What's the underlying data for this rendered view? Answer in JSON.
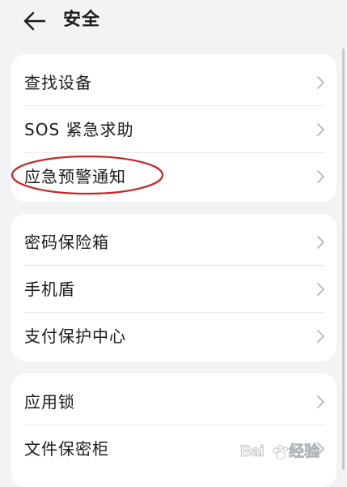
{
  "header": {
    "title": "安全",
    "back_icon": "arrow-left-icon"
  },
  "groups": [
    {
      "items": [
        {
          "label": "查找设备"
        },
        {
          "label": "SOS 紧急求助"
        },
        {
          "label": "应急预警通知"
        }
      ]
    },
    {
      "items": [
        {
          "label": "密码保险箱"
        },
        {
          "label": "手机盾"
        },
        {
          "label": "支付保护中心"
        }
      ]
    },
    {
      "items": [
        {
          "label": "应用锁"
        },
        {
          "label": "文件保密柜"
        }
      ]
    }
  ],
  "annotation": {
    "highlight_color": "#c0262b"
  },
  "watermark": {
    "text": "Baidu经验",
    "icon": "baidu-paw-logo"
  },
  "colors": {
    "background": "#f1f3f5",
    "card": "#ffffff",
    "text": "#1a1a1a",
    "chevron": "#b3b6ba"
  }
}
